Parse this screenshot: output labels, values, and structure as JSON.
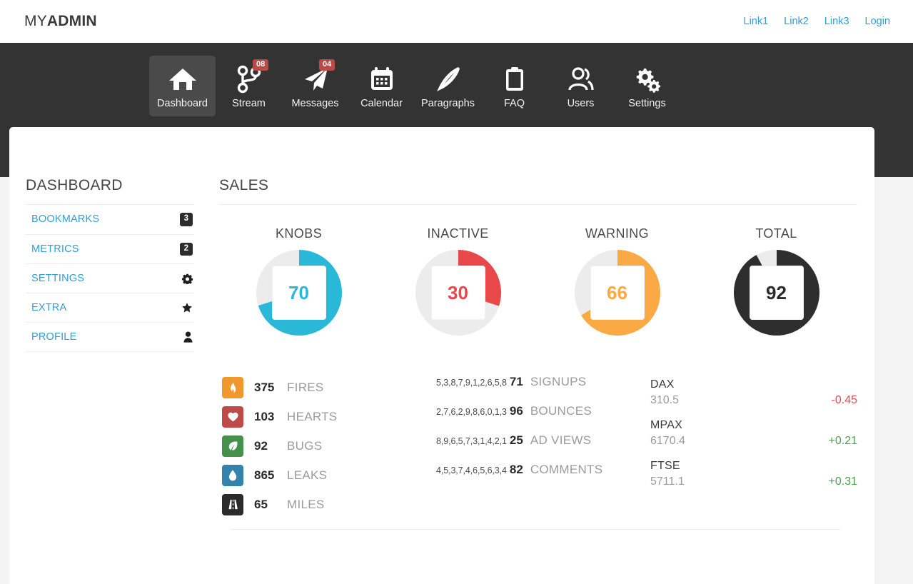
{
  "header": {
    "logo_light": "MY",
    "logo_bold": "ADMIN",
    "links": [
      {
        "label": "Link1"
      },
      {
        "label": "Link2"
      },
      {
        "label": "Link3"
      },
      {
        "label": "Login"
      }
    ]
  },
  "nav": {
    "items": [
      {
        "label": "Dashboard",
        "icon": "home-icon",
        "badge": "",
        "active": true
      },
      {
        "label": "Stream",
        "icon": "code-branch-icon",
        "badge": "08",
        "active": false
      },
      {
        "label": "Messages",
        "icon": "paper-plane-icon",
        "badge": "04",
        "active": false
      },
      {
        "label": "Calendar",
        "icon": "calendar-icon",
        "badge": "",
        "active": false
      },
      {
        "label": "Paragraphs",
        "icon": "feather-icon",
        "badge": "",
        "active": false
      },
      {
        "label": "FAQ",
        "icon": "clipboard-icon",
        "badge": "",
        "active": false
      },
      {
        "label": "Users",
        "icon": "users-icon",
        "badge": "",
        "active": false
      },
      {
        "label": "Settings",
        "icon": "gears-icon",
        "badge": "",
        "active": false
      }
    ]
  },
  "sidebar": {
    "title": "DASHBOARD",
    "items": [
      {
        "label": "BOOKMARKS",
        "badge": "3",
        "icon": ""
      },
      {
        "label": "METRICS",
        "badge": "2",
        "icon": ""
      },
      {
        "label": "SETTINGS",
        "badge": "",
        "icon": "gear-icon"
      },
      {
        "label": "EXTRA",
        "badge": "",
        "icon": "star-icon"
      },
      {
        "label": "PROFILE",
        "badge": "",
        "icon": "user-icon"
      }
    ]
  },
  "main": {
    "title": "SALES"
  },
  "chart_data": [
    {
      "type": "pie",
      "title": "KNOBS",
      "value": 70,
      "max": 100,
      "unit": "%",
      "color": "#29b8d8",
      "track_color": "#ececec",
      "label": "70"
    },
    {
      "type": "pie",
      "title": "INACTIVE",
      "value": 30,
      "max": 100,
      "unit": "%",
      "color": "#e8484a",
      "track_color": "#ececec",
      "label": "30"
    },
    {
      "type": "pie",
      "title": "WARNING",
      "value": 66,
      "max": 100,
      "unit": "%",
      "color": "#fba945",
      "track_color": "#ececec",
      "label": "66"
    },
    {
      "type": "pie",
      "title": "TOTAL",
      "value": 92,
      "max": 100,
      "unit": "%",
      "color": "#2e2e2e",
      "track_color": "#ececec",
      "label": "92"
    }
  ],
  "stats": [
    {
      "value": "375",
      "name": "FIRES",
      "icon": "fire-icon",
      "color": "#f0982d"
    },
    {
      "value": "103",
      "name": "HEARTS",
      "icon": "heart-icon",
      "color": "#bf4a4a"
    },
    {
      "value": "92",
      "name": "BUGS",
      "icon": "leaf-icon",
      "color": "#45914c"
    },
    {
      "value": "865",
      "name": "LEAKS",
      "icon": "droplet-icon",
      "color": "#3383ad"
    },
    {
      "value": "65",
      "name": "MILES",
      "icon": "road-icon",
      "color": "#2b2b2b"
    }
  ],
  "sparklines": [
    {
      "data": "5,3,8,7,9,1,2,6,5,8",
      "value": "71",
      "name": "SIGNUPS",
      "values": [
        5,
        3,
        8,
        7,
        9,
        1,
        2,
        6,
        5,
        8
      ]
    },
    {
      "data": "2,7,6,2,9,8,6,0,1,3",
      "value": "96",
      "name": "BOUNCES",
      "values": [
        2,
        7,
        6,
        2,
        9,
        8,
        6,
        0,
        1,
        3
      ]
    },
    {
      "data": "8,9,6,5,7,3,1,4,2,1",
      "value": "25",
      "name": "AD VIEWS",
      "values": [
        8,
        9,
        6,
        5,
        7,
        3,
        1,
        4,
        2,
        1
      ]
    },
    {
      "data": "4,5,3,7,4,6,5,6,3,4",
      "value": "82",
      "name": "COMMENTS",
      "values": [
        4,
        5,
        3,
        7,
        4,
        6,
        5,
        6,
        3,
        4
      ]
    }
  ],
  "tickers": [
    {
      "name": "DAX",
      "value": "310.5",
      "change": "-0.45",
      "direction": "down"
    },
    {
      "name": "MPAX",
      "value": "6170.4",
      "change": "+0.21",
      "direction": "up"
    },
    {
      "name": "FTSE",
      "value": "5711.1",
      "change": "+0.31",
      "direction": "up"
    }
  ],
  "colors": {
    "accent_blue": "#2f9fd8",
    "cyan": "#29b8d8",
    "red": "#e8484a",
    "orange": "#fba945",
    "dark": "#2e2e2e",
    "green": "#4fa04f",
    "badge_red": "#b94a48"
  }
}
